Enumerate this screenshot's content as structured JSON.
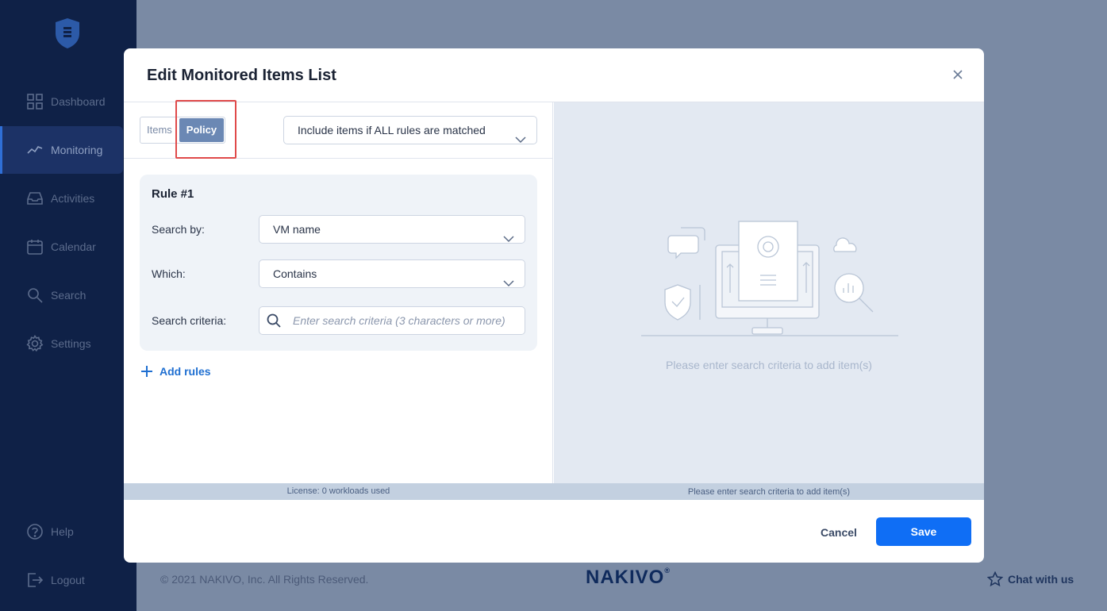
{
  "sidebar": {
    "items": [
      {
        "label": "Dashboard",
        "icon": "grid-icon"
      },
      {
        "label": "Monitoring",
        "icon": "chart-line-icon",
        "active": true
      },
      {
        "label": "Activities",
        "icon": "inbox-icon"
      },
      {
        "label": "Calendar",
        "icon": "calendar-icon"
      },
      {
        "label": "Search",
        "icon": "search-icon"
      },
      {
        "label": "Settings",
        "icon": "gear-icon"
      }
    ],
    "bottom": [
      {
        "label": "Help",
        "icon": "help-icon"
      },
      {
        "label": "Logout",
        "icon": "logout-icon"
      }
    ]
  },
  "footer": {
    "copyright": "© 2021 NAKIVO, Inc. All Rights Reserved.",
    "brand": "NAKIVO",
    "brand_mark": "®",
    "chat": "Chat with us"
  },
  "modal": {
    "title": "Edit Monitored Items List",
    "tabs": [
      "Items",
      "Policy"
    ],
    "selected_tab": "Policy",
    "match_mode": "Include items if ALL rules are matched",
    "rule": {
      "title": "Rule #1",
      "search_by_label": "Search by:",
      "search_by_value": "VM name",
      "which_label": "Which:",
      "which_value": "Contains",
      "criteria_label": "Search criteria:",
      "criteria_placeholder": "Enter search criteria (3 characters or more)"
    },
    "add_rules": "Add rules",
    "empty_message": "Please enter search criteria to add item(s)",
    "status_left": "License: 0 workloads used",
    "status_right": "Please enter search criteria to add item(s)",
    "cancel": "Cancel",
    "save": "Save"
  },
  "colors": {
    "sidebar_bg": "#0f2147",
    "accent": "#0f6ef5",
    "selected_tab": "#6b88b4",
    "highlight": "#e04a4a"
  }
}
